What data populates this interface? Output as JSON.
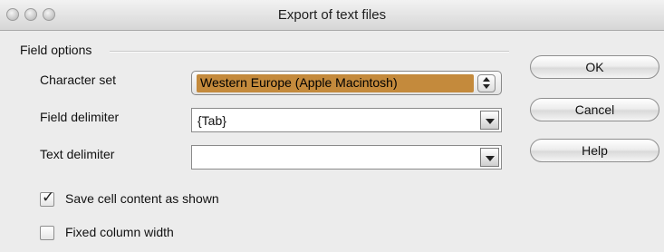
{
  "window": {
    "title": "Export of text files"
  },
  "field_options": {
    "group_label": "Field options",
    "character_set": {
      "label": "Character set",
      "value": "Western Europe (Apple Macintosh)"
    },
    "field_delimiter": {
      "label": "Field delimiter",
      "value": "{Tab}"
    },
    "text_delimiter": {
      "label": "Text delimiter",
      "value": ""
    },
    "save_cell_content": {
      "label": "Save cell content as shown",
      "checked": true,
      "check_glyph": "✓"
    },
    "fixed_column_width": {
      "label": "Fixed column width",
      "checked": false
    }
  },
  "buttons": {
    "ok": "OK",
    "cancel": "Cancel",
    "help": "Help"
  },
  "colors": {
    "selection_highlight": "#c48a3c",
    "window_background": "#ececec"
  }
}
